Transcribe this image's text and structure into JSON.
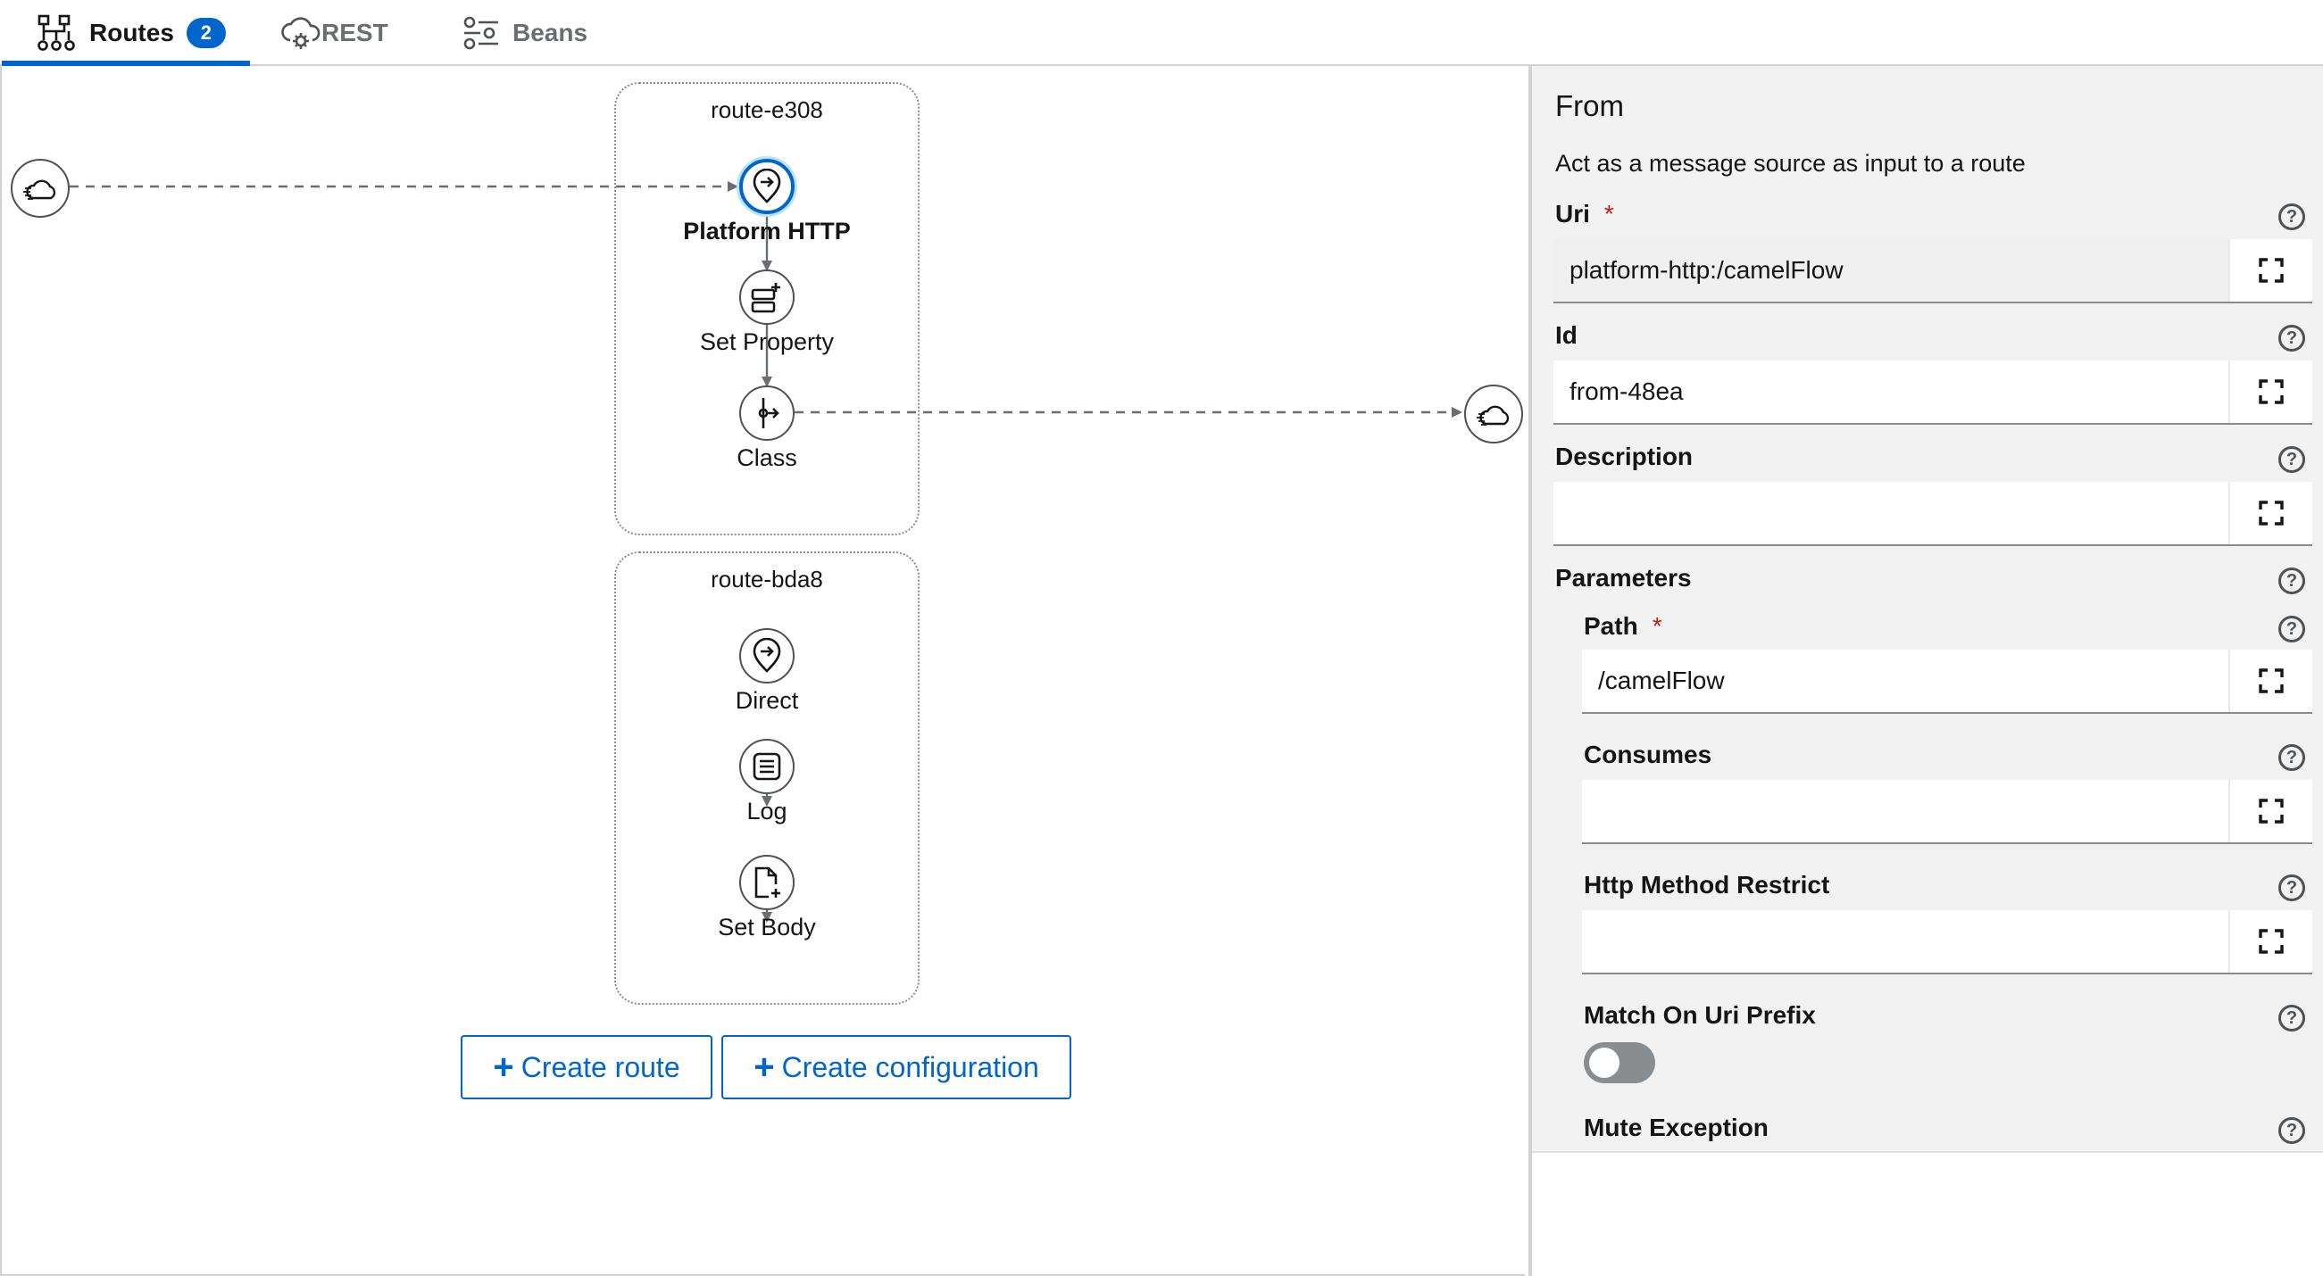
{
  "tabs": [
    {
      "label": "Routes",
      "badge": "2",
      "icon": "routes-icon"
    },
    {
      "label": "REST",
      "icon": "cloud-gear-icon"
    },
    {
      "label": "Beans",
      "icon": "sliders-icon"
    }
  ],
  "canvas": {
    "routes": [
      {
        "title": "route-e308",
        "nodes": [
          {
            "label": "Platform HTTP",
            "icon": "from-endpoint-icon",
            "selected": true
          },
          {
            "label": "Set Property",
            "icon": "set-property-icon"
          },
          {
            "label": "Class",
            "icon": "class-icon"
          }
        ]
      },
      {
        "title": "route-bda8",
        "nodes": [
          {
            "label": "Direct",
            "icon": "from-endpoint-icon"
          },
          {
            "label": "Log",
            "icon": "log-icon"
          },
          {
            "label": "Set Body",
            "icon": "set-body-icon"
          }
        ]
      }
    ],
    "actions": {
      "create_route": "Create route",
      "create_configuration": "Create configuration"
    }
  },
  "panel": {
    "title": "From",
    "description": "Act as a message source as input to a route",
    "fields": {
      "uri": {
        "label": "Uri",
        "required": "*",
        "value": "platform-http:/camelFlow"
      },
      "id": {
        "label": "Id",
        "value": "from-48ea"
      },
      "description": {
        "label": "Description",
        "value": ""
      },
      "parameters": {
        "label": "Parameters"
      },
      "path": {
        "label": "Path",
        "required": "*",
        "value": "/camelFlow"
      },
      "consumes": {
        "label": "Consumes",
        "value": ""
      },
      "http_method_restrict": {
        "label": "Http Method Restrict",
        "value": ""
      },
      "match_on_uri_prefix": {
        "label": "Match On Uri Prefix",
        "checked": false
      },
      "mute_exception": {
        "label": "Mute Exception"
      }
    },
    "help_symbol": "?"
  },
  "colors": {
    "accent": "#0066cc",
    "required": "#c9190b",
    "border": "#d2d2d2",
    "panel_bg": "#f2f2f2"
  }
}
